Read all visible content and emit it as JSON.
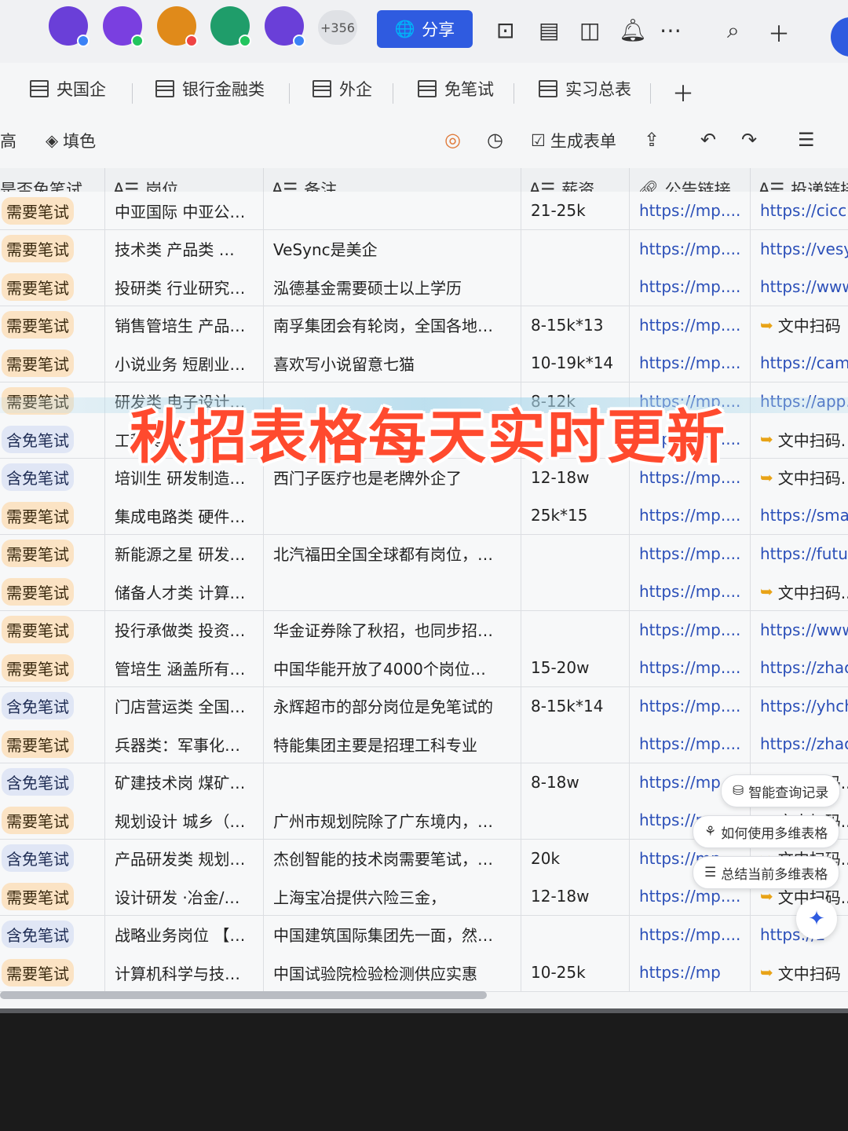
{
  "topbar": {
    "avatar_colors": [
      "#6a3fd8",
      "#7a3fe0",
      "#e08a1a",
      "#1f9d6a",
      "#6a3fd8"
    ],
    "avatar_dot_colors": [
      "#3b82f6",
      "#22c55e",
      "#ef4444",
      "#22c55e",
      "#3b82f6"
    ],
    "more_count": "+356",
    "share_label": "分享",
    "accent": "#2f5be0"
  },
  "tabs": [
    "央国企",
    "银行金融类",
    "外企",
    "免笔试",
    "实习总表"
  ],
  "toolbar": {
    "left_cut": "高",
    "fill_label": "填色",
    "form_label": "生成表单"
  },
  "headers": {
    "exam": "是否免笔试",
    "position": "岗位",
    "note": "备注",
    "salary": "薪资",
    "notice": "公告链接",
    "apply": "投递链接"
  },
  "rows": [
    {
      "exam": "需要笔试",
      "kind": "need",
      "position": "中亚国际 中亚公…",
      "note": "",
      "salary": "21-25k",
      "notice": "https://mp....",
      "apply": "https://cicc"
    },
    {
      "exam": "需要笔试",
      "kind": "need",
      "position": "技术类 产品类 …",
      "note": "VeSync是美企",
      "salary": "",
      "notice": "https://mp....",
      "apply": "https://vesy"
    },
    {
      "exam": "需要笔试",
      "kind": "need",
      "position": "投研类 行业研究…",
      "note": "泓德基金需要硕士以上学历",
      "salary": "",
      "notice": "https://mp....",
      "apply": "https://www"
    },
    {
      "exam": "需要笔试",
      "kind": "need",
      "position": "销售管培生 产品…",
      "note": "南孚集团会有轮岗，全国各地…",
      "salary": "8-15k*13",
      "notice": "https://mp....",
      "apply": "文中扫码"
    },
    {
      "exam": "需要笔试",
      "kind": "need",
      "position": "小说业务 短剧业…",
      "note": "喜欢写小说留意七猫",
      "salary": "10-19k*14",
      "notice": "https://mp....",
      "apply": "https://camp"
    },
    {
      "exam": "需要笔试",
      "kind": "need",
      "position": "研发类 电子设计…",
      "note": "",
      "salary": "8-12k",
      "notice": "https://mp....",
      "apply": "https://app.."
    },
    {
      "exam": "含免笔试",
      "kind": "free",
      "position": "工程类 …",
      "note": "",
      "salary": "",
      "notice": "https://mp....",
      "apply": "文中扫码."
    },
    {
      "exam": "含免笔试",
      "kind": "free",
      "position": "培训生 研发制造…",
      "note": "西门子医疗也是老牌外企了",
      "salary": "12-18w",
      "notice": "https://mp....",
      "apply": "文中扫码."
    },
    {
      "exam": "需要笔试",
      "kind": "need",
      "position": "集成电路类 硬件…",
      "note": "",
      "salary": "25k*15",
      "notice": "https://mp....",
      "apply": "https://smar"
    },
    {
      "exam": "需要笔试",
      "kind": "need",
      "position": "新能源之星 研发…",
      "note": "北汽福田全国全球都有岗位，…",
      "salary": "",
      "notice": "https://mp....",
      "apply": "https://futur"
    },
    {
      "exam": "需要笔试",
      "kind": "need",
      "position": "储备人才类 计算…",
      "note": "",
      "salary": "",
      "notice": "https://mp....",
      "apply": "文中扫码.."
    },
    {
      "exam": "需要笔试",
      "kind": "need",
      "position": "投行承做类 投资…",
      "note": "华金证券除了秋招，也同步招…",
      "salary": "",
      "notice": "https://mp....",
      "apply": "https://www."
    },
    {
      "exam": "需要笔试",
      "kind": "need",
      "position": "管培生 涵盖所有…",
      "note": "中国华能开放了4000个岗位…",
      "salary": "15-20w",
      "notice": "https://mp....",
      "apply": "https://zhao."
    },
    {
      "exam": "含免笔试",
      "kind": "free",
      "position": "门店营运类 全国…",
      "note": "永辉超市的部分岗位是免笔试的",
      "salary": "8-15k*14",
      "notice": "https://mp....",
      "apply": "https://yhch."
    },
    {
      "exam": "需要笔试",
      "kind": "need",
      "position": "兵器类：军事化…",
      "note": "特能集团主要是招理工科专业",
      "salary": "",
      "notice": "https://mp....",
      "apply": "https://zhao."
    },
    {
      "exam": "含免笔试",
      "kind": "free",
      "position": "矿建技术岗 煤矿…",
      "note": "",
      "salary": "8-18w",
      "notice": "https://mp..",
      "apply": "文中扫码.."
    },
    {
      "exam": "需要笔试",
      "kind": "need",
      "position": "规划设计 城乡（…",
      "note": "广州市规划院除了广东境内，…",
      "salary": "",
      "notice": "https://mp",
      "apply": "文中扫码.."
    },
    {
      "exam": "含免笔试",
      "kind": "free",
      "position": "产品研发类 规划…",
      "note": "杰创智能的技术岗需要笔试，…",
      "salary": "20k",
      "notice": "https://mp....",
      "apply": "文中扫码.."
    },
    {
      "exam": "需要笔试",
      "kind": "need",
      "position": "设计研发 ·冶金/…",
      "note": "上海宝冶提供六险三金，",
      "salary": "12-18w",
      "notice": "https://mp....",
      "apply": "文中扫码.."
    },
    {
      "exam": "含免笔试",
      "kind": "free",
      "position": "战略业务岗位 【…",
      "note": "中国建筑国际集团先一面，然…",
      "salary": "",
      "notice": "https://mp....",
      "apply": "https://z"
    },
    {
      "exam": "需要笔试",
      "kind": "need",
      "position": "计算机科学与技…",
      "note": "中国试验院检验检测供应实惠",
      "salary": "10-25k",
      "notice": "https://mp",
      "apply": "文中扫码"
    }
  ],
  "floating": {
    "query_history": "智能查询记录",
    "how_to_use": "如何使用多维表格",
    "summarize": "总结当前多维表格"
  },
  "banner": "秋招表格每天实时更新",
  "colors": {
    "need_tag": "#fbe3c4",
    "free_tag": "#e0e6f5",
    "link": "#2b4fb8",
    "banner": "#ff4a2e"
  }
}
